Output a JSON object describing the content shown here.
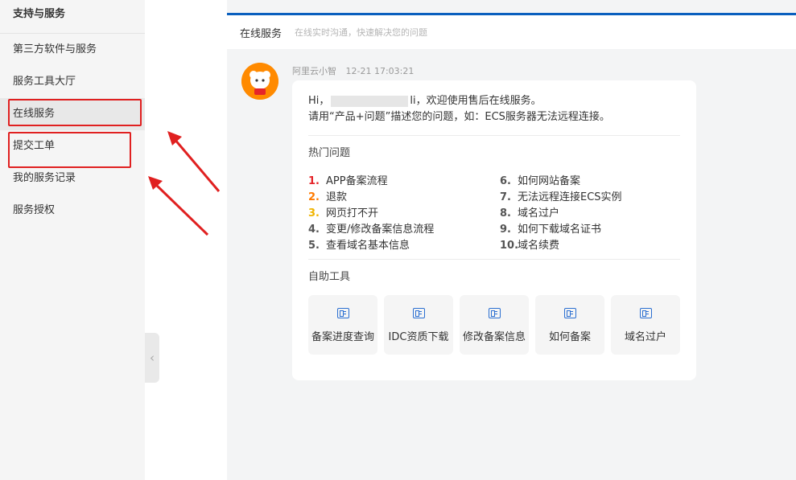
{
  "sidebar": {
    "title": "支持与服务",
    "items": [
      {
        "label": "第三方软件与服务"
      },
      {
        "label": "服务工具大厅"
      },
      {
        "label": "在线服务"
      },
      {
        "label": "提交工单"
      },
      {
        "label": "我的服务记录"
      },
      {
        "label": "服务授权"
      }
    ],
    "collapse_icon": "‹"
  },
  "header": {
    "title": "在线服务",
    "subtitle": "在线实时沟通，快速解决您的问题"
  },
  "message": {
    "sender": "阿里云小智",
    "time": "12-21 17:03:21",
    "greeting_prefix": "Hi，",
    "greeting_suffix": "li，欢迎使用售后在线服务。",
    "instruction": "请用“产品+问题”描述您的问题，如：ECS服务器无法远程连接。",
    "hot_title": "热门问题",
    "questions": [
      {
        "num": "1.",
        "text": "APP备案流程"
      },
      {
        "num": "2.",
        "text": "退款"
      },
      {
        "num": "3.",
        "text": "网页打不开"
      },
      {
        "num": "4.",
        "text": "变更/修改备案信息流程"
      },
      {
        "num": "5.",
        "text": "查看域名基本信息"
      },
      {
        "num": "6.",
        "text": "如何网站备案"
      },
      {
        "num": "7.",
        "text": "无法远程连接ECS实例"
      },
      {
        "num": "8.",
        "text": "域名过户"
      },
      {
        "num": "9.",
        "text": "如何下载域名证书"
      },
      {
        "num": "10.",
        "text": "域名续费"
      }
    ],
    "tools_title": "自助工具",
    "tools": [
      {
        "label": "备案进度查询",
        "icon": "form-icon"
      },
      {
        "label": "IDC资质下载",
        "icon": "form-icon"
      },
      {
        "label": "修改备案信息",
        "icon": "form-icon"
      },
      {
        "label": "如何备案",
        "icon": "form-icon"
      },
      {
        "label": "域名过户",
        "icon": "form-icon"
      }
    ]
  },
  "colors": {
    "accent": "#0a5fbe",
    "annotation": "#e02020",
    "num1": "#e5252a",
    "num2": "#ff7a00",
    "num3": "#f0b400"
  }
}
